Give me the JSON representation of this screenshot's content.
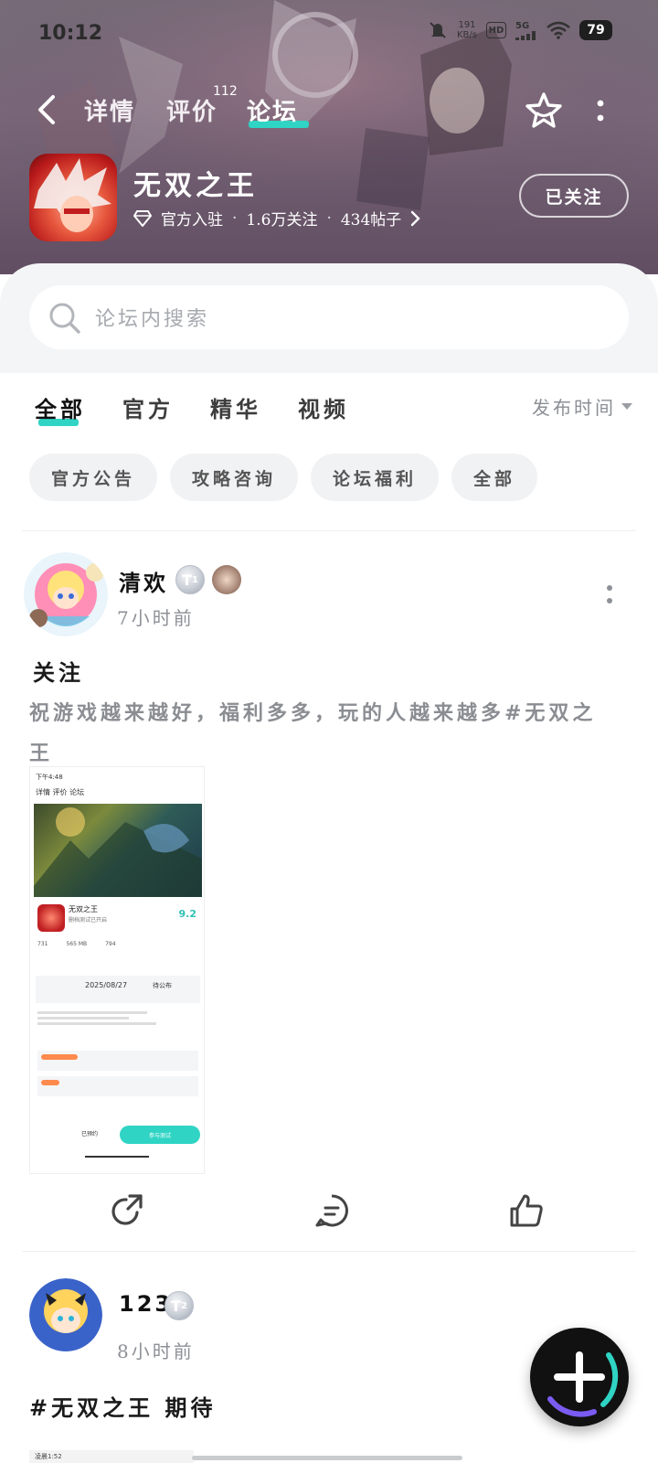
{
  "status_bar": {
    "time": "10:12",
    "net_speed_value": "191",
    "net_speed_unit": "KB/s",
    "hd": "HD",
    "signal": "5G",
    "battery": "79"
  },
  "nav": {
    "tabs": [
      "详情",
      "评价",
      "论坛"
    ],
    "review_count": "112",
    "active_tab": "论坛"
  },
  "game": {
    "name": "无双之王",
    "official_label": "官方入驻",
    "followers": "1.6万关注",
    "posts": "434帖子",
    "follow_button": "已关注"
  },
  "search": {
    "placeholder": "论坛内搜索"
  },
  "filters": {
    "tabs": [
      "全部",
      "官方",
      "精华",
      "视频"
    ],
    "sort": "发布时间",
    "chips": [
      "官方公告",
      "攻略咨询",
      "论坛福利",
      "全部"
    ]
  },
  "posts": [
    {
      "author": "清欢",
      "level": "1",
      "time": "7小时前",
      "title": "关注",
      "body": "祝游戏越来越好，福利多多，玩的人越来越多#无双之王",
      "screenshot": {
        "time": "下午4:48",
        "nav": "详情  评价  论坛",
        "game_name": "无双之王",
        "game_sub": "删档测试已开启",
        "score": "9.2",
        "stats": [
          "731",
          "565 MB",
          "794"
        ],
        "date": "2025/08/27",
        "pending": "待公布",
        "booked": "已预约",
        "join": "参与测试"
      }
    },
    {
      "author": "123",
      "level": "2",
      "time": "8小时前",
      "title": "#无双之王 期待",
      "screenshot_time": "凌晨1:52"
    }
  ],
  "colors": {
    "accent": "#2fd4c4",
    "text": "#111111",
    "muted": "#8d9096"
  }
}
